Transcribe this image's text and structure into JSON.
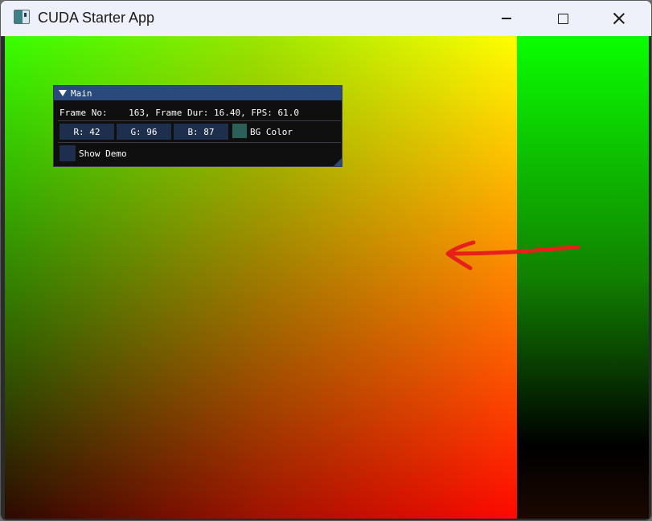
{
  "window": {
    "title": "CUDA Starter App"
  },
  "imgui": {
    "panel_title": "Main",
    "frame_line": "Frame No:    163, Frame Dur: 16.40, FPS: 61.0",
    "r_field": "R: 42",
    "g_field": "G: 96",
    "b_field": "B: 87",
    "bg_color_label": "BG Color",
    "bg_color_hex": "#2a6057",
    "show_demo_label": "Show Demo",
    "show_demo_checked": false
  },
  "icons": [
    "app-icon",
    "minimize-icon",
    "maximize-icon",
    "close-icon",
    "collapse-triangle-icon",
    "red-arrow-annotation"
  ],
  "colors": {
    "panel_title_bg": "#294a7a",
    "field_bg": "#1d2f4d",
    "annotation": "#e8201c"
  }
}
